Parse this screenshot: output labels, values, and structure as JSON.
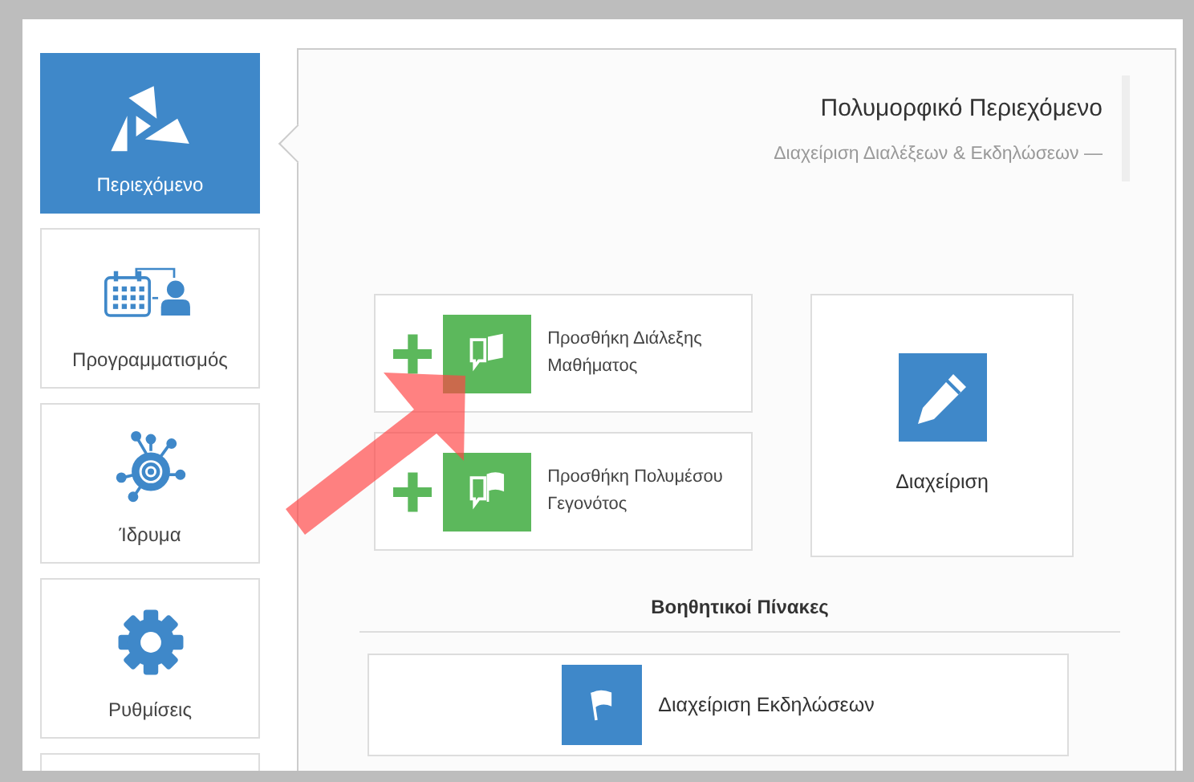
{
  "sidebar": {
    "items": [
      {
        "label": "Περιεχόμενο",
        "selected": true
      },
      {
        "label": "Προγραμματισμός",
        "selected": false
      },
      {
        "label": "Ίδρυμα",
        "selected": false
      },
      {
        "label": "Ρυθμίσεις",
        "selected": false
      }
    ]
  },
  "header": {
    "title": "Πολυμορφικό Περιεχόμενο",
    "subtitle": "Διαχείριση Διαλέξεων & Εκδηλώσεων —"
  },
  "actions": [
    {
      "label": "Προσθήκη Διάλεξης Μαθήματος"
    },
    {
      "label": "Προσθήκη Πολυμέσου Γεγονότος"
    }
  ],
  "manage_tile": {
    "label": "Διαχείριση"
  },
  "section": {
    "title": "Βοηθητικοί Πίνακες",
    "items": [
      {
        "label": "Διαχείριση Εκδηλώσεων"
      }
    ]
  }
}
